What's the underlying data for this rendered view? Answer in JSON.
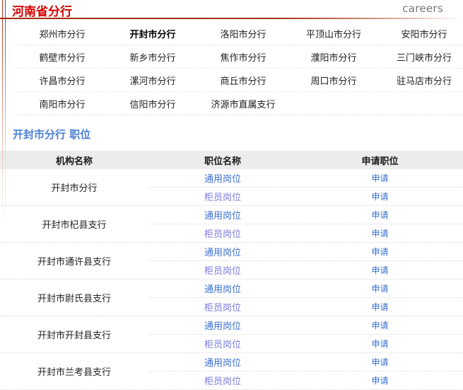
{
  "header": {
    "site_title": "河南省分行",
    "careers_label": "careers"
  },
  "branch_grid": {
    "rows": [
      [
        "郑州市分行",
        "开封市分行",
        "洛阳市分行",
        "平顶山市分行",
        "安阳市分行"
      ],
      [
        "鹤壁市分行",
        "新乡市分行",
        "焦作市分行",
        "濮阳市分行",
        "三门峡市分行"
      ],
      [
        "许昌市分行",
        "漯河市分行",
        "商丘市分行",
        "周口市分行",
        "驻马店市分行"
      ],
      [
        "南阳市分行",
        "信阳市分行",
        "济源市直属支行",
        "",
        ""
      ]
    ],
    "selected": "开封市分行"
  },
  "positions_section": {
    "title": "开封市分行 职位",
    "columns": [
      "机构名称",
      "职位名称",
      "申请职位"
    ],
    "apply_label": "申请",
    "groups": [
      {
        "org": "开封市分行",
        "positions": [
          {
            "name": "通用岗位",
            "visited": false,
            "apply": "申请"
          },
          {
            "name": "柜员岗位",
            "visited": true,
            "apply": "申请"
          }
        ]
      },
      {
        "org": "开封市杞县支行",
        "positions": [
          {
            "name": "通用岗位",
            "visited": false,
            "apply": "申请"
          },
          {
            "name": "柜员岗位",
            "visited": true,
            "apply": "申请"
          }
        ]
      },
      {
        "org": "开封市通许县支行",
        "positions": [
          {
            "name": "通用岗位",
            "visited": false,
            "apply": "申请"
          },
          {
            "name": "柜员岗位",
            "visited": true,
            "apply": "申请"
          }
        ]
      },
      {
        "org": "开封市尉氏县支行",
        "positions": [
          {
            "name": "通用岗位",
            "visited": false,
            "apply": "申请"
          },
          {
            "name": "柜员岗位",
            "visited": true,
            "apply": "申请"
          }
        ]
      },
      {
        "org": "开封市开封县支行",
        "positions": [
          {
            "name": "通用岗位",
            "visited": false,
            "apply": "申请"
          },
          {
            "name": "柜员岗位",
            "visited": true,
            "apply": "申请"
          }
        ]
      },
      {
        "org": "开封市兰考县支行",
        "positions": [
          {
            "name": "通用岗位",
            "visited": false,
            "apply": "申请"
          },
          {
            "name": "柜员岗位",
            "visited": true,
            "apply": "申请"
          }
        ]
      }
    ]
  },
  "colors": {
    "title_red": "#d40000",
    "section_blue": "#4a7fd4",
    "link_blue": "#3a6fd0",
    "link_visited": "#7a7ae0",
    "header_band": "#ececec"
  }
}
